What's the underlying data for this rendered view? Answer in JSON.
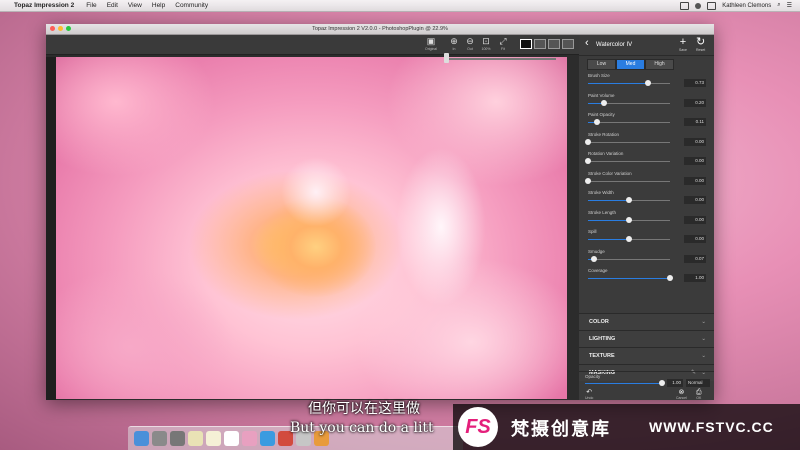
{
  "menubar": {
    "app": "Topaz Impression 2",
    "menus": [
      "File",
      "Edit",
      "View",
      "Help",
      "Community"
    ],
    "user": "Kathleen Clemons"
  },
  "window": {
    "title": "Topaz Impression 2 V2.0.0 - PhotoshopPlugin @ 22.9%"
  },
  "toolbar": {
    "original_label": "Original",
    "zoom_in_label": "In",
    "zoom_out_label": "Out",
    "zoom_100_label": "100%",
    "fit_label": "Fit"
  },
  "panel": {
    "preset_name": "Watercolor IV",
    "save_label": "Save",
    "reset_label": "Reset",
    "quality_options": [
      "Low",
      "Med",
      "High"
    ],
    "quality_selected": "Med",
    "params": [
      {
        "name": "Brush Size",
        "value": "0.73",
        "level": 0.73
      },
      {
        "name": "Paint Volume",
        "value": "0.20",
        "level": 0.2
      },
      {
        "name": "Paint Opacity",
        "value": "0.11",
        "level": 0.11
      },
      {
        "name": "Stroke Rotation",
        "value": "0.00",
        "level": 0.0
      },
      {
        "name": "Rotation Variation",
        "value": "0.00",
        "level": 0.0
      },
      {
        "name": "Stroke Color Variation",
        "value": "0.00",
        "level": 0.0
      },
      {
        "name": "Stroke Width",
        "value": "0.00",
        "level": 0.5
      },
      {
        "name": "Stroke Length",
        "value": "0.00",
        "level": 0.5
      },
      {
        "name": "Spill",
        "value": "0.00",
        "level": 0.5
      },
      {
        "name": "Smudge",
        "value": "0.07",
        "level": 0.07
      },
      {
        "name": "Coverage",
        "value": "1.00",
        "level": 1.0
      }
    ],
    "sections": [
      "COLOR",
      "LIGHTING",
      "TEXTURE",
      "MASKING"
    ],
    "opacity_label": "Opacity",
    "opacity_value": "1.00",
    "blend_mode": "Normal",
    "undo_label": "Undo",
    "cancel_label": "Cancel",
    "ok_label": "OK"
  },
  "colors": {
    "accent": "#2a7de1",
    "panel_bg": "#3b3b3b"
  },
  "subtitles": {
    "chinese": "但你可以在这里做",
    "english": "But you can do a litt"
  },
  "watermark": {
    "logo": "FS",
    "text": "梵摄创意库",
    "url": "WWW.FSTVC.CC"
  }
}
